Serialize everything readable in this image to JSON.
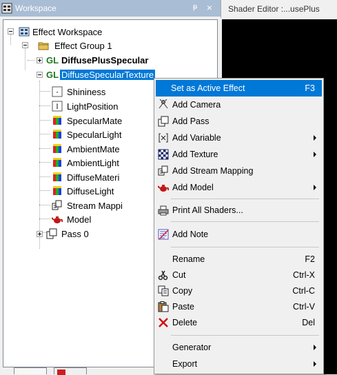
{
  "workspace_pane": {
    "title": "Workspace",
    "pin": "ᵽ"
  },
  "tree": {
    "root": "Effect Workspace",
    "group": "Effect Group 1",
    "gl_badge": "GL",
    "effect1": "DiffusePlusSpecular",
    "effect2": "DiffuseSpecularTexture",
    "children": [
      {
        "label": "Shininess",
        "icon": "float-variable-icon"
      },
      {
        "label": "LightPosition",
        "icon": "vector-variable-icon"
      },
      {
        "label": "SpecularMate",
        "icon": "color-variable-icon"
      },
      {
        "label": "SpecularLight",
        "icon": "color-variable-icon"
      },
      {
        "label": "AmbientMate",
        "icon": "color-variable-icon"
      },
      {
        "label": "AmbientLight",
        "icon": "color-variable-icon"
      },
      {
        "label": "DiffuseMateri",
        "icon": "color-variable-icon"
      },
      {
        "label": "DiffuseLight",
        "icon": "color-variable-icon"
      },
      {
        "label": "Stream Mappi",
        "icon": "stream-mapping-icon"
      },
      {
        "label": "Model",
        "icon": "teapot-icon"
      },
      {
        "label": "Pass 0",
        "icon": "pass-icon"
      }
    ]
  },
  "editor": {
    "tab_title": "Shader Editor :...usePlus"
  },
  "context_menu": {
    "items": [
      {
        "label": "Set as Active Effect",
        "shortcut": "F3",
        "highlighted": true
      },
      {
        "label": "Add Camera",
        "icon": "camera-icon"
      },
      {
        "label": "Add Pass",
        "icon": "pass-icon"
      },
      {
        "label": "Add Variable",
        "icon": "variable-icon",
        "submenu": true
      },
      {
        "label": "Add Texture",
        "icon": "texture-icon",
        "submenu": true
      },
      {
        "label": "Add Stream Mapping",
        "icon": "stream-mapping-icon"
      },
      {
        "label": "Add Model",
        "icon": "teapot-icon",
        "submenu": true
      },
      {
        "label": "Print All Shaders...",
        "icon": "printer-icon"
      },
      {
        "label": "Add Note",
        "icon": "note-icon"
      },
      {
        "label": "Rename",
        "shortcut": "F2"
      },
      {
        "label": "Cut",
        "shortcut": "Ctrl-X",
        "icon": "scissors-icon"
      },
      {
        "label": "Copy",
        "shortcut": "Ctrl-C",
        "icon": "copy-icon"
      },
      {
        "label": "Paste",
        "shortcut": "Ctrl-V",
        "icon": "paste-icon"
      },
      {
        "label": "Delete",
        "shortcut": "Del",
        "icon": "delete-icon"
      },
      {
        "label": "Generator",
        "submenu": true
      },
      {
        "label": "Export",
        "submenu": true
      }
    ]
  },
  "colors": {
    "title_bar": "#a9bdd4",
    "selection": "#0078d7",
    "gl_green": "#1c7a1c",
    "editor_bg": "#000000"
  }
}
